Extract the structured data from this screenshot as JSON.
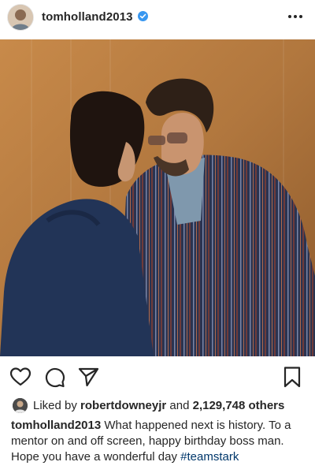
{
  "header": {
    "username": "tomholland2013",
    "verified_icon": "verified-badge-icon",
    "more_icon": "more-options-icon"
  },
  "post": {
    "image_alt_icon": "photo"
  },
  "actions": {
    "like_icon": "heart-icon",
    "comment_icon": "comment-icon",
    "share_icon": "paper-plane-icon",
    "save_icon": "bookmark-icon"
  },
  "likes": {
    "prefix": "Liked by",
    "liker": "robertdowneyjr",
    "connector": "and",
    "count": "2,129,748 others"
  },
  "caption": {
    "username": "tomholland2013",
    "text": "What happened next is history. To a mentor on and off screen, happy birthday boss man. Hope you have a wonderful day",
    "hashtag": "#teamstark"
  },
  "colors": {
    "verified": "#3897f0",
    "hashtag": "#00376b",
    "text": "#262626"
  }
}
